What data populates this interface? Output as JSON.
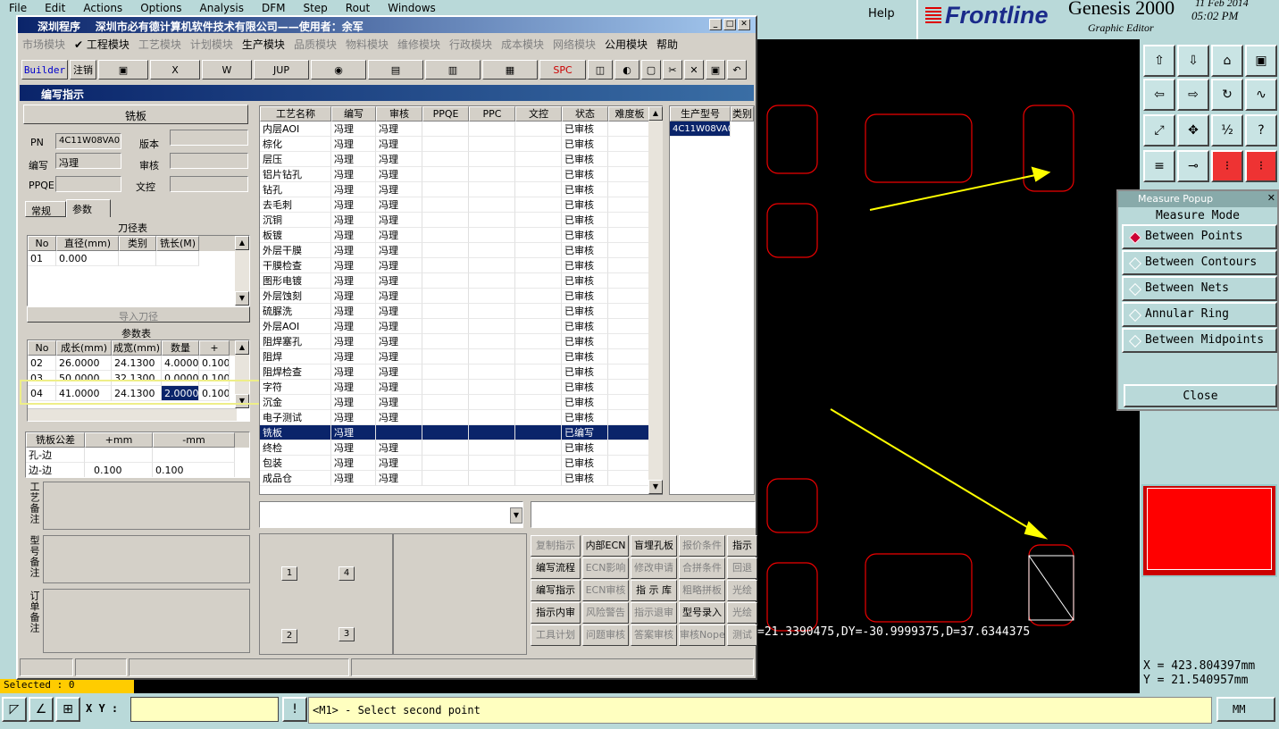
{
  "genesis": {
    "menu": [
      "File",
      "Edit",
      "Actions",
      "Options",
      "Analysis",
      "DFM",
      "Step",
      "Rout",
      "Windows"
    ],
    "help": "Help",
    "brand": "Frontline",
    "product": "Genesis 2000",
    "editor": "Graphic Editor",
    "date": "11 Feb 2014",
    "time": "05:02 PM",
    "coord_x": "X = 423.804397mm",
    "coord_y": "Y = 21.540957mm",
    "xy_label": "X Y :",
    "prompt": "<M1> - Select second point",
    "unit": "MM",
    "selected": "Selected : 0",
    "measure_text": "=21.3390475,DY=-30.9999375,D=37.6344375"
  },
  "popup": {
    "title": "Measure Popup",
    "mode": "Measure Mode",
    "options": [
      "Between Points",
      "Between Contours",
      "Between Nets",
      "Annular Ring",
      "Between Midpoints"
    ],
    "close": "Close"
  },
  "win": {
    "title": "深圳程序",
    "company": "深圳市必有德计算机软件技术有限公司——使用者：余军",
    "menu": [
      "市场模块",
      "✔ 工程模块",
      "工艺模块",
      "计划模块",
      "生产模块",
      "品质模块",
      "物料模块",
      "维修模块",
      "行政模块",
      "成本模块",
      "网络模块",
      "公用模块",
      "帮助"
    ],
    "toolbar": [
      "Builder",
      "注销",
      "▣",
      "X",
      "W",
      "JUP",
      "◉",
      "▤",
      "▥",
      "▦",
      "SPC",
      "◫",
      "◐",
      "▢",
      "✂",
      "✕",
      "▣",
      "↶"
    ],
    "subtitle": "编写指示"
  },
  "left": {
    "section": "铣板",
    "pn_label": "PN",
    "pn": "4C11W08VA0",
    "ver_label": "版本",
    "author_label": "编写",
    "author": "冯理",
    "audit_label": "审核",
    "ppqe_label": "PPQE",
    "doc_label": "文控",
    "tab1": "常规",
    "tab2": "参数",
    "tool_title": "刀径表",
    "tool_cols": [
      "No",
      "直径(mm)",
      "类别",
      "铣长(M)"
    ],
    "tool_rows": [
      [
        "01",
        "0.000",
        "",
        ""
      ]
    ],
    "import_btn": "导入刀径",
    "param_title": "参数表",
    "param_cols": [
      "No",
      "成长(mm)",
      "成宽(mm)",
      "数量",
      "+"
    ],
    "param_rows": [
      [
        "02",
        "26.0000",
        "24.1300",
        "4.0000",
        "0.100"
      ],
      [
        "03",
        "50.0000",
        "32.1300",
        "0.0000",
        "0.100"
      ],
      [
        "04",
        "41.0000",
        "24.1300",
        "2.0000",
        "0.100"
      ]
    ],
    "tol_cols": [
      "铣板公差",
      "+mm",
      "-mm"
    ],
    "tol_rows": [
      [
        "孔-边",
        "",
        ""
      ],
      [
        "边-边",
        "0.100",
        "0.100"
      ]
    ],
    "note1": "工艺备注",
    "note2": "型号备注",
    "note3": "订单备注"
  },
  "table": {
    "cols": [
      "工艺名称",
      "编写",
      "审核",
      "PPQE",
      "PPC",
      "文控",
      "状态",
      "难度板"
    ],
    "rows": [
      [
        "内层AOI",
        "冯理",
        "冯理",
        "",
        "",
        "",
        "已审核",
        ""
      ],
      [
        "棕化",
        "冯理",
        "冯理",
        "",
        "",
        "",
        "已审核",
        ""
      ],
      [
        "层压",
        "冯理",
        "冯理",
        "",
        "",
        "",
        "已审核",
        ""
      ],
      [
        "铝片钻孔",
        "冯理",
        "冯理",
        "",
        "",
        "",
        "已审核",
        ""
      ],
      [
        "钻孔",
        "冯理",
        "冯理",
        "",
        "",
        "",
        "已审核",
        ""
      ],
      [
        "去毛刺",
        "冯理",
        "冯理",
        "",
        "",
        "",
        "已审核",
        ""
      ],
      [
        "沉铜",
        "冯理",
        "冯理",
        "",
        "",
        "",
        "已审核",
        ""
      ],
      [
        "板镀",
        "冯理",
        "冯理",
        "",
        "",
        "",
        "已审核",
        ""
      ],
      [
        "外层干膜",
        "冯理",
        "冯理",
        "",
        "",
        "",
        "已审核",
        ""
      ],
      [
        "干膜检查",
        "冯理",
        "冯理",
        "",
        "",
        "",
        "已审核",
        ""
      ],
      [
        "图形电镀",
        "冯理",
        "冯理",
        "",
        "",
        "",
        "已审核",
        ""
      ],
      [
        "外层蚀刻",
        "冯理",
        "冯理",
        "",
        "",
        "",
        "已审核",
        ""
      ],
      [
        "硫脲洗",
        "冯理",
        "冯理",
        "",
        "",
        "",
        "已审核",
        ""
      ],
      [
        "外层AOI",
        "冯理",
        "冯理",
        "",
        "",
        "",
        "已审核",
        ""
      ],
      [
        "阻焊塞孔",
        "冯理",
        "冯理",
        "",
        "",
        "",
        "已审核",
        ""
      ],
      [
        "阻焊",
        "冯理",
        "冯理",
        "",
        "",
        "",
        "已审核",
        ""
      ],
      [
        "阻焊检查",
        "冯理",
        "冯理",
        "",
        "",
        "",
        "已审核",
        ""
      ],
      [
        "字符",
        "冯理",
        "冯理",
        "",
        "",
        "",
        "已审核",
        ""
      ],
      [
        "沉金",
        "冯理",
        "冯理",
        "",
        "",
        "",
        "已审核",
        ""
      ],
      [
        "电子测试",
        "冯理",
        "冯理",
        "",
        "",
        "",
        "已审核",
        ""
      ],
      [
        "铣板",
        "冯理",
        "",
        "",
        "",
        "",
        "已编写",
        ""
      ],
      [
        "终检",
        "冯理",
        "冯理",
        "",
        "",
        "",
        "已审核",
        ""
      ],
      [
        "包装",
        "冯理",
        "冯理",
        "",
        "",
        "",
        "已审核",
        ""
      ],
      [
        "成品仓",
        "冯理",
        "冯理",
        "",
        "",
        "",
        "已审核",
        ""
      ]
    ],
    "selected_index": 20,
    "prod_cols": [
      "生产型号",
      "类别"
    ],
    "prod_rows": [
      [
        "4C11W08VA0",
        ""
      ]
    ]
  },
  "nums": [
    "1",
    "4",
    "2",
    "3"
  ],
  "actions": [
    [
      "复制指示",
      "内部ECN",
      "盲埋孔板",
      "报价条件",
      "指示"
    ],
    [
      "编写流程",
      "ECN影响",
      "修改申请",
      "合拼条件",
      "回退"
    ],
    [
      "编写指示",
      "ECN审核",
      "指 示 库",
      "粗略拼板",
      "光绘"
    ],
    [
      "指示内审",
      "风险警告",
      "指示退审",
      "型号录入",
      "光绘"
    ],
    [
      "工具计划",
      "问题审核",
      "答案审核",
      "审核Nope",
      "测试"
    ]
  ],
  "actions_dis": [
    [
      true,
      false,
      false,
      true,
      false
    ],
    [
      false,
      true,
      true,
      true,
      true
    ],
    [
      false,
      true,
      false,
      true,
      true
    ],
    [
      false,
      true,
      true,
      false,
      true
    ],
    [
      true,
      true,
      true,
      true,
      true
    ]
  ]
}
